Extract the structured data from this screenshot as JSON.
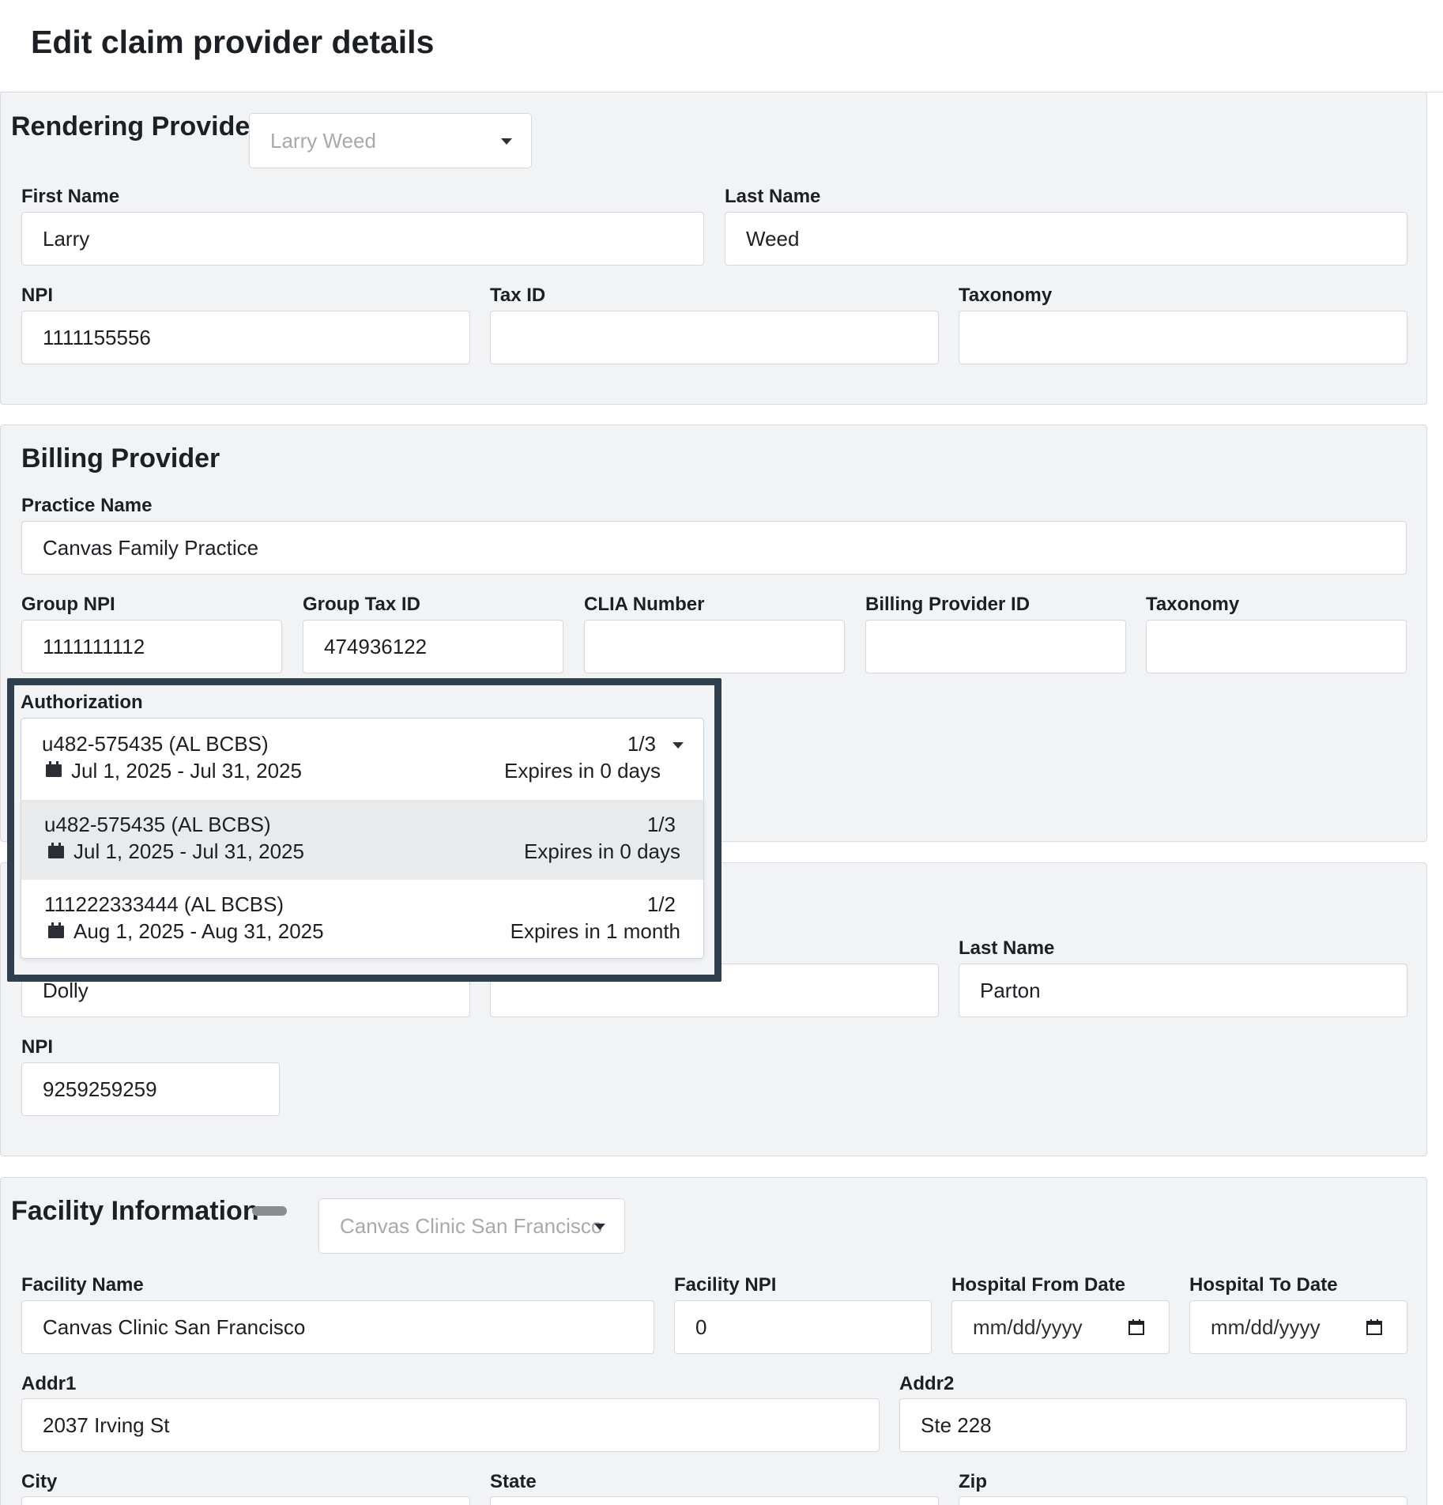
{
  "page": {
    "title": "Edit claim provider details"
  },
  "rendering": {
    "title": "Rendering Provider",
    "select_value": "Larry Weed",
    "first_name_label": "First Name",
    "first_name": "Larry",
    "last_name_label": "Last Name",
    "last_name": "Weed",
    "npi_label": "NPI",
    "npi": "1111155556",
    "tax_id_label": "Tax ID",
    "tax_id": "",
    "taxonomy_label": "Taxonomy",
    "taxonomy": ""
  },
  "billing": {
    "title": "Billing Provider",
    "practice_name_label": "Practice Name",
    "practice_name": "Canvas Family Practice",
    "group_npi_label": "Group NPI",
    "group_npi": "1111111112",
    "group_tax_id_label": "Group Tax ID",
    "group_tax_id": "474936122",
    "clia_label": "CLIA Number",
    "clia": "",
    "billing_provider_id_label": "Billing Provider ID",
    "billing_provider_id": "",
    "taxonomy_label": "Taxonomy",
    "taxonomy": ""
  },
  "authorization": {
    "label": "Authorization",
    "selected": {
      "id": "u482-575435 (AL BCBS)",
      "count": "1/3",
      "dates": "Jul 1, 2025 - Jul 31, 2025",
      "expires": "Expires in 0 days"
    },
    "options": [
      {
        "id": "u482-575435 (AL BCBS)",
        "count": "1/3",
        "dates": "Jul 1, 2025 - Jul 31, 2025",
        "expires": "Expires in 0 days"
      },
      {
        "id": "111222333444 (AL BCBS)",
        "count": "1/2",
        "dates": "Aug 1, 2025 - Aug 31, 2025",
        "expires": "Expires in 1 month"
      }
    ]
  },
  "referring": {
    "first_name": "Dolly",
    "middle_name": "",
    "last_name_label": "Last Name",
    "last_name": "Parton",
    "npi_label": "NPI",
    "npi": "9259259259"
  },
  "facility": {
    "title": "Facility Information",
    "select_value": "Canvas Clinic San Francisco",
    "name_label": "Facility Name",
    "name": "Canvas Clinic San Francisco",
    "npi_label": "Facility NPI",
    "npi": "0",
    "from_label": "Hospital From Date",
    "from_placeholder": "mm/dd/yyyy",
    "to_label": "Hospital To Date",
    "to_placeholder": "mm/dd/yyyy",
    "addr1_label": "Addr1",
    "addr1": "2037 Irving St",
    "addr2_label": "Addr2",
    "addr2": "Ste 228",
    "city_label": "City",
    "state_label": "State",
    "zip_label": "Zip"
  },
  "colors": {
    "highlight": "#2f3f4d",
    "section_bg": "#f2f3f5",
    "hover_option": "#e9eaec"
  }
}
